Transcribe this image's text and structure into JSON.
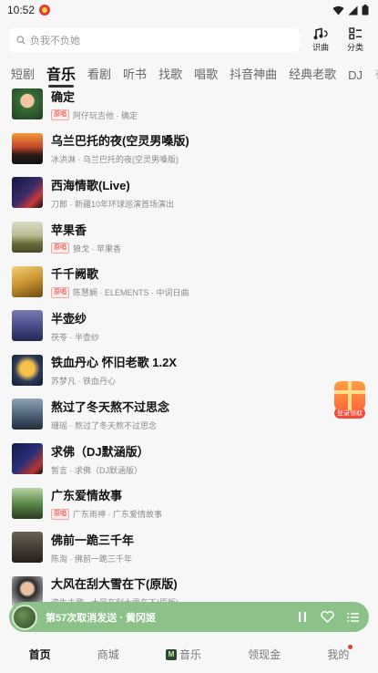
{
  "status_bar": {
    "time": "10:52"
  },
  "search": {
    "placeholder": "负我不负她"
  },
  "top_actions": [
    {
      "label": "识曲",
      "icon": "music-recognize-icon"
    },
    {
      "label": "分类",
      "icon": "category-grid-icon"
    }
  ],
  "tabs": [
    "短剧",
    "音乐",
    "看剧",
    "听书",
    "找歌",
    "唱歌",
    "抖音神曲",
    "经典老歌",
    "DJ",
    "有"
  ],
  "active_tab": "音乐",
  "songs": [
    {
      "title": "确定",
      "badge": "原唱",
      "subtitle": "阿仔玩吉他 · 确定"
    },
    {
      "title": "乌兰巴托的夜(空灵男嗓版)",
      "badge": "",
      "subtitle": "冰洪淋 · 乌兰巴托的夜(空灵男嗓版)"
    },
    {
      "title": "西海情歌(Live)",
      "badge": "",
      "subtitle": "刀郎 · 新疆10年环球巡演首场演出"
    },
    {
      "title": "苹果香",
      "badge": "原唱",
      "subtitle": "狼戈 · 苹果香"
    },
    {
      "title": "千千阙歌",
      "badge": "原唱",
      "subtitle": "陈慧娴 · ELEMENTS · 中词日曲"
    },
    {
      "title": "半壶纱",
      "badge": "",
      "subtitle": "茯苓 · 半壶纱"
    },
    {
      "title": "铁血丹心 怀旧老歌 1.2X",
      "badge": "",
      "subtitle": "苏梦凡 · 铁血丹心"
    },
    {
      "title": "熬过了冬天熬不过思念",
      "badge": "",
      "subtitle": "珊瑶 · 熬过了冬天熬不过思念"
    },
    {
      "title": "求佛（DJ默涵版）",
      "badge": "",
      "subtitle": "暂言 · 求佛（DJ默涵版）"
    },
    {
      "title": "广东爱情故事",
      "badge": "原唱",
      "subtitle": "广东雨神 · 广东爱情故事"
    },
    {
      "title": "佛前一跪三千年",
      "badge": "",
      "subtitle": "陈淘 · 佛前一跪三千年"
    },
    {
      "title": "大风在刮大雪在下(原版)",
      "badge": "",
      "subtitle": "滚生未歌 · 大风在刮大雪在下(原版)"
    }
  ],
  "float_reward": {
    "label": "登录领取"
  },
  "player": {
    "now_playing": "第57次取消发送 · 黄冈姬"
  },
  "bottom_nav": [
    {
      "label": "首页",
      "active": true
    },
    {
      "label": "商城",
      "active": false
    },
    {
      "label": "音乐",
      "active": false
    },
    {
      "label": "领现金",
      "active": false
    },
    {
      "label": "我的",
      "active": false
    }
  ],
  "colors": {
    "accent_green": "#8cc18a",
    "badge_red": "#e53935",
    "background": "#f7f7f7"
  }
}
